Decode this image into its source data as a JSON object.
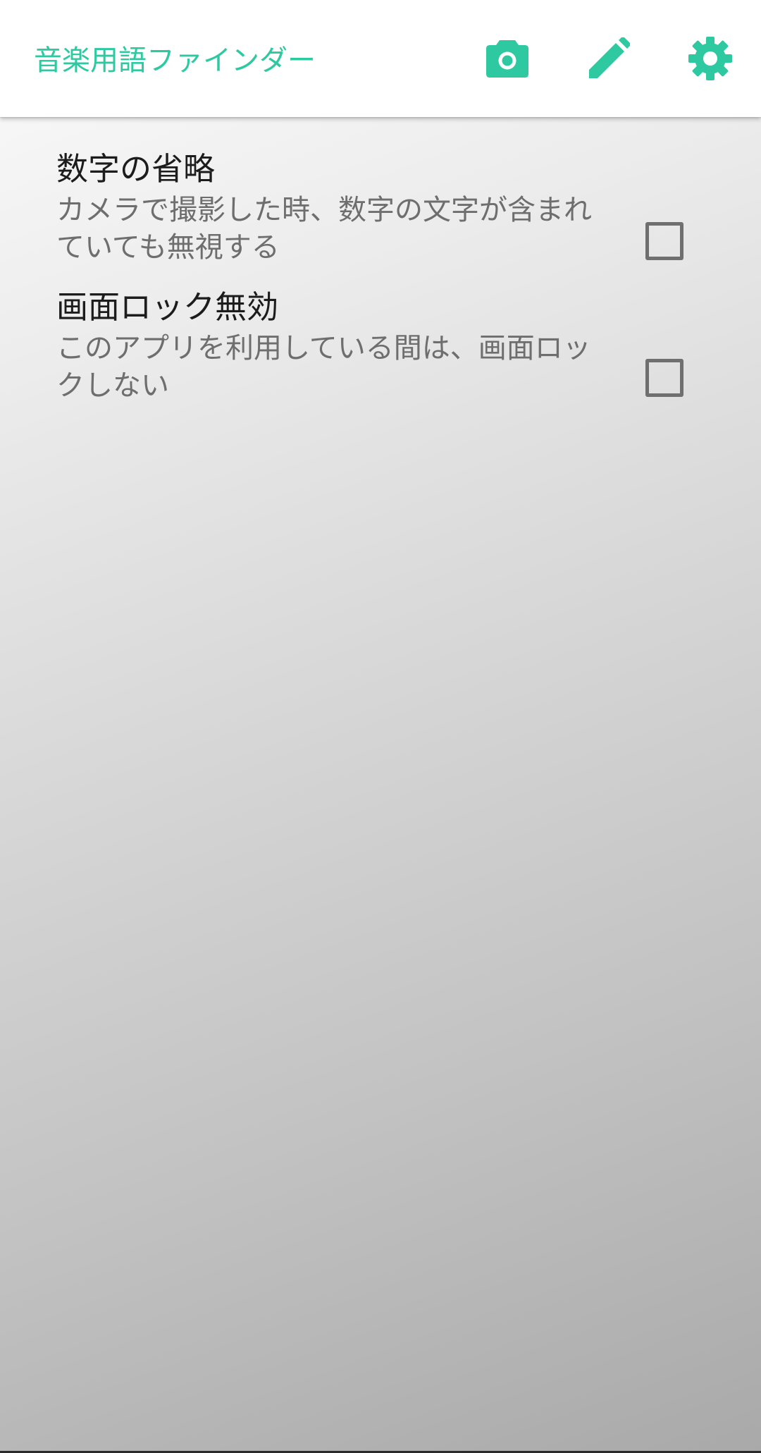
{
  "app_bar": {
    "title": "音楽用語ファインダー",
    "accent_color": "#2ec9a0",
    "actions": [
      {
        "icon": "camera-icon"
      },
      {
        "icon": "pencil-icon"
      },
      {
        "icon": "gear-icon"
      }
    ]
  },
  "preferences": [
    {
      "title": "数字の省略",
      "summary": "カメラで撮影した時、数字の文字が含まれていても無視する",
      "checked": false
    },
    {
      "title": "画面ロック無効",
      "summary": "このアプリを利用している間は、画面ロックしない",
      "checked": false
    }
  ]
}
